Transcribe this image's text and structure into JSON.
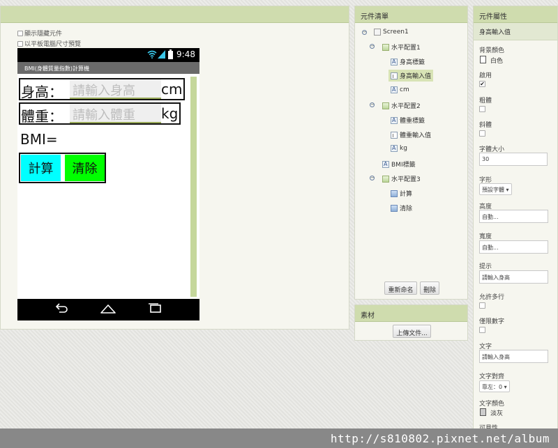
{
  "viewer": {
    "options": [
      {
        "label": "顯示隱藏元件",
        "checked": false
      },
      {
        "label": "以平板電腦尺寸預覽",
        "checked": false
      }
    ],
    "phone": {
      "time": "9:48",
      "app_title": "BMI(身體質量指數)計算機",
      "height_label": "身高：",
      "height_hint": "請輸入身高",
      "height_unit": "cm",
      "weight_label": "體重：",
      "weight_hint": "請輸入體重",
      "weight_unit": "kg",
      "bmi_label": "BMI=",
      "calc_button": "計算",
      "clear_button": "清除",
      "calc_color": "#00ffff",
      "clear_color": "#00ff00"
    }
  },
  "components": {
    "title": "元件清單",
    "tree": [
      {
        "label": "Screen1",
        "icon": "screen-icon"
      },
      {
        "label": "水平配置1",
        "icon": "horizontal-arrangement-icon"
      },
      {
        "label": "身高標籤",
        "icon": "label-icon"
      },
      {
        "label": "身高輸入值",
        "icon": "textbox-icon",
        "selected": true
      },
      {
        "label": "cm",
        "icon": "label-icon"
      },
      {
        "label": "水平配置2",
        "icon": "horizontal-arrangement-icon"
      },
      {
        "label": "體重標籤",
        "icon": "label-icon"
      },
      {
        "label": "體重輸入值",
        "icon": "textbox-icon"
      },
      {
        "label": "kg",
        "icon": "label-icon"
      },
      {
        "label": "BMI標籤",
        "icon": "label-icon"
      },
      {
        "label": "水平配置3",
        "icon": "horizontal-arrangement-icon"
      },
      {
        "label": "計算",
        "icon": "button-icon"
      },
      {
        "label": "清除",
        "icon": "button-icon"
      }
    ],
    "rename_button": "重新命名",
    "delete_button": "刪除"
  },
  "media": {
    "title": "素材",
    "upload_button": "上傳文件..."
  },
  "properties": {
    "title": "元件屬性",
    "component_name": "身高輸入值",
    "bg_color_label": "背景顏色",
    "bg_color_value": "白色",
    "enabled_label": "啟用",
    "enabled": true,
    "bold_label": "粗體",
    "italic_label": "斜體",
    "font_size_label": "字體大小",
    "font_size_value": "30",
    "font_face_label": "字形",
    "font_face_value": "預設字體 ▾",
    "height_label": "高度",
    "height_value": "自動...",
    "width_label": "寬度",
    "width_value": "自動...",
    "hint_label": "提示",
    "hint_value": "請輸入身高",
    "multiline_label": "允許多行",
    "numbers_only_label": "僅限數字",
    "text_label": "文字",
    "text_value": "請輸入身高",
    "align_label": "文字對齊",
    "align_value": "靠左：0 ▾",
    "text_color_label": "文字顏色",
    "text_color_value": "淡灰",
    "visible_label": "可見性"
  },
  "watermark": "http://s810802.pixnet.net/album"
}
